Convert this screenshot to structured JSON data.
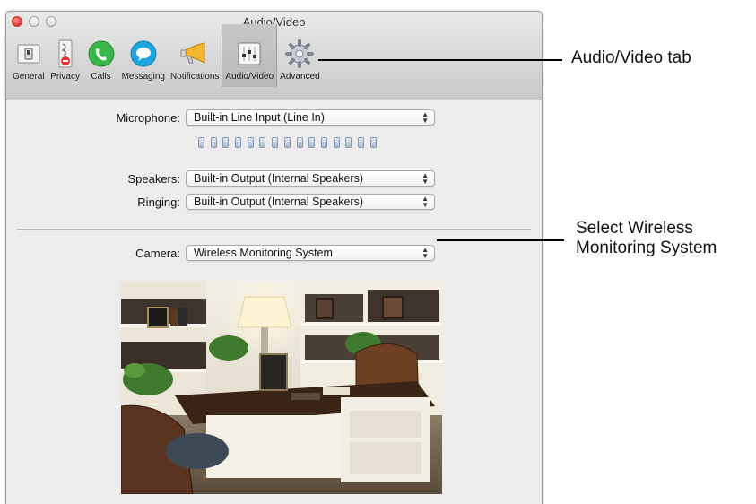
{
  "window": {
    "title": "Audio/Video"
  },
  "toolbar": {
    "items": [
      {
        "label": "General",
        "icon": "general-switch-icon"
      },
      {
        "label": "Privacy",
        "icon": "privacy-icon"
      },
      {
        "label": "Calls",
        "icon": "phone-icon"
      },
      {
        "label": "Messaging",
        "icon": "chat-bubble-icon"
      },
      {
        "label": "Notifications",
        "icon": "megaphone-icon"
      },
      {
        "label": "Audio/Video",
        "icon": "mixer-sliders-icon",
        "selected": true
      },
      {
        "label": "Advanced",
        "icon": "gear-icon"
      }
    ]
  },
  "form": {
    "microphone": {
      "label": "Microphone:",
      "value": "Built-in Line Input (Line In)"
    },
    "speakers": {
      "label": "Speakers:",
      "value": "Built-in Output (Internal Speakers)"
    },
    "ringing": {
      "label": "Ringing:",
      "value": "Built-in Output (Internal Speakers)"
    },
    "camera": {
      "label": "Camera:",
      "value": "Wireless Monitoring System"
    },
    "input_level_segments": 15,
    "input_level_fraction": 0
  },
  "callouts": {
    "tab": "Audio/Video tab",
    "camera_line1": "Select Wireless",
    "camera_line2": "Monitoring System"
  },
  "colors": {
    "close_button": "#e0443e",
    "calls_icon": "#3ab54a",
    "messaging_icon": "#1fa6de",
    "notifications_icon": "#f2b630"
  }
}
